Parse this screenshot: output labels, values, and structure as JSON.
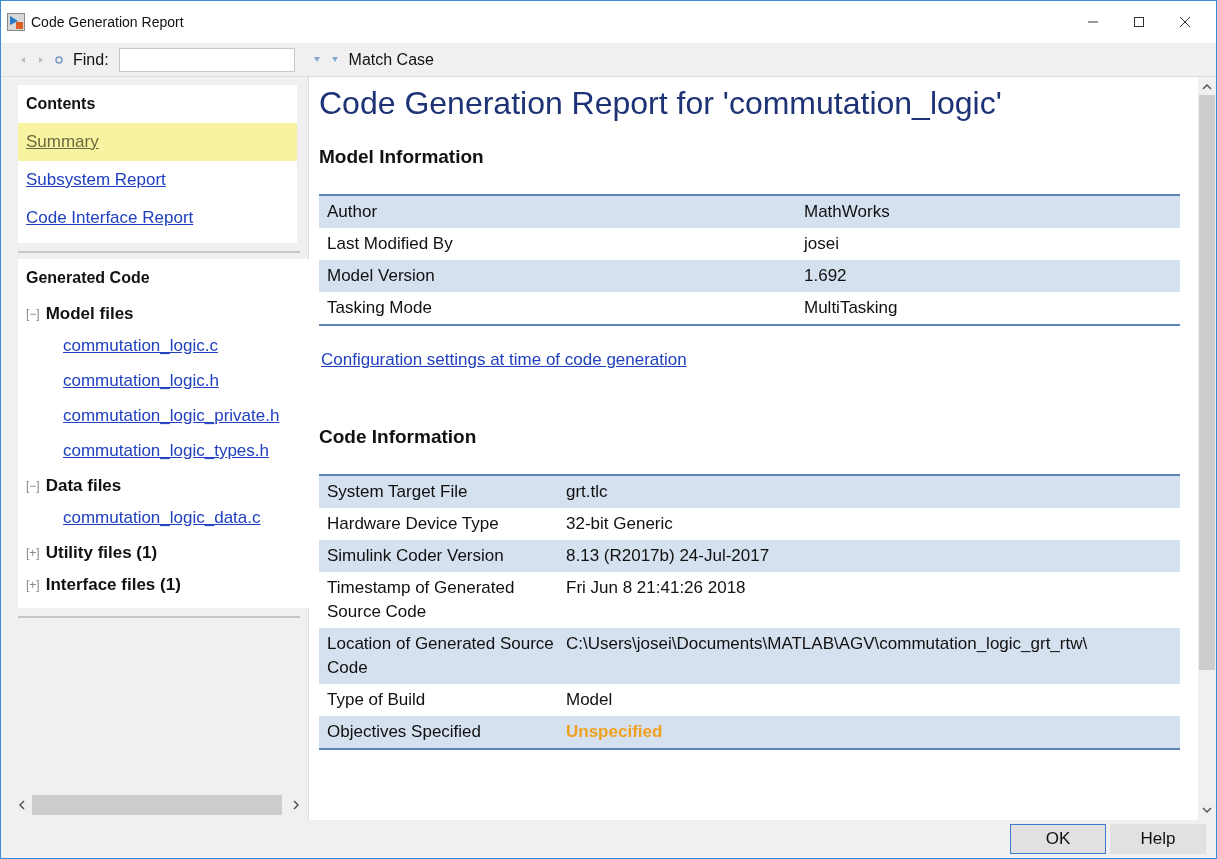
{
  "window": {
    "title": "Code Generation Report"
  },
  "toolbar": {
    "find_label": "Find:",
    "match_case": "Match Case"
  },
  "contents": {
    "heading": "Contents",
    "items": [
      {
        "label": "Summary",
        "selected": true
      },
      {
        "label": "Subsystem Report",
        "selected": false
      },
      {
        "label": "Code Interface Report",
        "selected": false
      }
    ]
  },
  "generated_code": {
    "heading": "Generated Code",
    "groups": [
      {
        "toggle": "[−]",
        "label": "Model files",
        "children": [
          "commutation_logic.c",
          "commutation_logic.h",
          "commutation_logic_private.h",
          "commutation_logic_types.h"
        ]
      },
      {
        "toggle": "[−]",
        "label": "Data files",
        "children": [
          "commutation_logic_data.c"
        ]
      },
      {
        "toggle": "[+]",
        "label": "Utility files (1)"
      },
      {
        "toggle": "[+]",
        "label": "Interface files (1)"
      }
    ]
  },
  "report": {
    "title": "Code Generation Report for 'commutation_logic'",
    "model_information": {
      "heading": "Model Information",
      "rows": [
        {
          "label": "Author",
          "value": "MathWorks",
          "kind": "plain"
        },
        {
          "label": "Last Modified By",
          "value": "josei",
          "kind": "plain"
        },
        {
          "label": "Model Version",
          "value": "1.692",
          "kind": "plain"
        },
        {
          "label": "Tasking Mode",
          "value": "MultiTasking",
          "kind": "plain"
        }
      ]
    },
    "config_link": "Configuration settings at time of code generation",
    "code_information": {
      "heading": "Code Information",
      "rows": [
        {
          "label": "System Target File",
          "value": "grt.tlc",
          "kind": "plain"
        },
        {
          "label": "Hardware Device Type",
          "value": "32-bit Generic",
          "kind": "plain"
        },
        {
          "label": "Simulink Coder Version",
          "value": "8.13 (R2017b) 24-Jul-2017",
          "kind": "plain"
        },
        {
          "label": "Timestamp of Generated Source Code",
          "value": "Fri Jun 8 21:41:26 2018",
          "kind": "plain"
        },
        {
          "label": "Location of Generated Source Code",
          "value": "C:\\Users\\josei\\Documents\\MATLAB\\AGV\\commutation_logic_grt_rtw\\",
          "kind": "plain"
        },
        {
          "label": "Type of Build",
          "value": "Model",
          "kind": "plain"
        },
        {
          "label": "Objectives Specified",
          "value": "Unspecified",
          "kind": "warning"
        }
      ]
    }
  },
  "buttons": [
    "OK",
    "Help"
  ]
}
